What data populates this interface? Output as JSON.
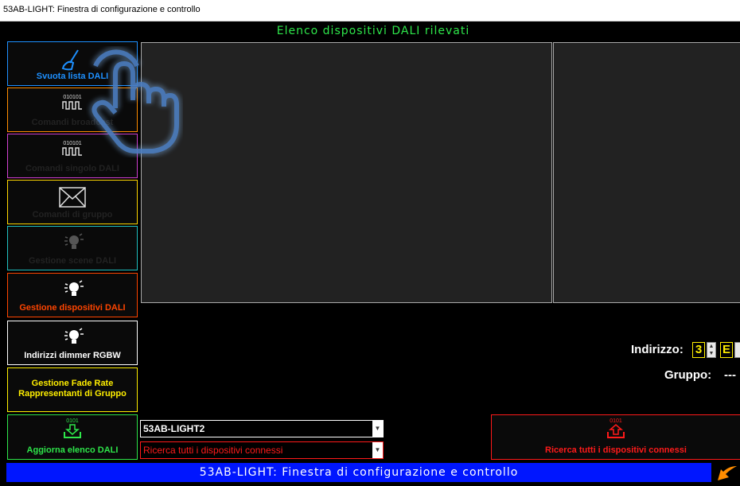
{
  "window": {
    "title": "53AB-LIGHT: Finestra di configurazione e controllo"
  },
  "header": {
    "title": "Elenco dispositivi DALI rilevati"
  },
  "sidebar": {
    "buttons": [
      {
        "label": "Svuota lista DALI",
        "color": "#1e90ff",
        "icon": "broom-icon"
      },
      {
        "label": "Comandi broadcast",
        "color": "#ff8c00",
        "icon": "binary-signal-icon"
      },
      {
        "label": "Comandi singolo DALI",
        "color": "#d040d0",
        "icon": "binary-signal-icon"
      },
      {
        "label": "Comandi di gruppo",
        "color": "#ffd700",
        "icon": "envelope-icon"
      },
      {
        "label": "Gestione scene DALI",
        "color": "#20c0c0",
        "icon": "lightbulb-icon"
      },
      {
        "label": "Gestione dispositivi DALI",
        "color": "#ff4500",
        "icon": "lightbulb-icon"
      },
      {
        "label": "Indirizzi dimmer RGBW",
        "color": "#ffffff",
        "icon": "lightbulb-icon"
      },
      {
        "label": "Gestione Fade Rate Rappresentanti di Gruppo",
        "color": "#ffef00",
        "icon": ""
      },
      {
        "label": "Aggiorna elenco DALI",
        "color": "#2ee64a",
        "icon": "download-icon"
      }
    ]
  },
  "address": {
    "label": "Indirizzo:",
    "value": "3",
    "type_value": "E",
    "group_label": "Gruppo:",
    "group_value": "---"
  },
  "combos": {
    "device": "53AB-LIGHT2",
    "action": "Ricerca tutti i dispositivi connessi"
  },
  "search_button": {
    "label": "Ricerca tutti i dispositivi connessi",
    "code": "0101"
  },
  "update_button": {
    "code": "0101"
  },
  "binary_code": "010101",
  "footer": {
    "title": "53AB-LIGHT: Finestra di configurazione e controllo"
  },
  "colors": {
    "header_green": "#2ee64a",
    "footer_blue": "#0016ff",
    "accent_yellow": "#ffef00",
    "alert_red": "#ff1a1a"
  }
}
